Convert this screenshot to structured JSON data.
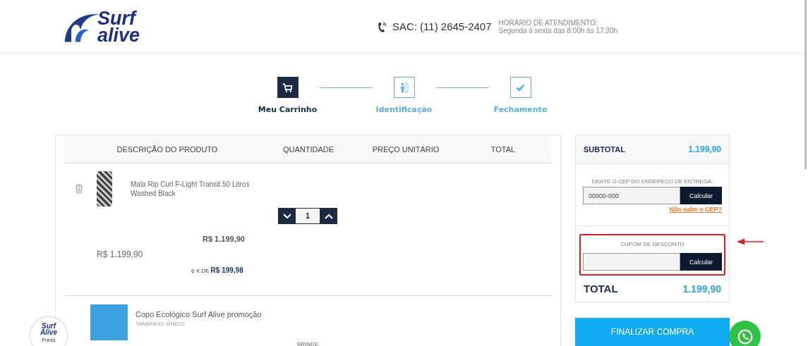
{
  "header": {
    "logo": {
      "line_1": "Surf",
      "line_2": "alive"
    },
    "phone": "SAC: (11) 2645-2407",
    "hours_title": "HORÁRIO DE ATENDIMENTO:",
    "hours": "Segunda à sexta das 8:00h às 17:30h"
  },
  "steps": [
    {
      "label": "Meu Carrinho",
      "kind": "cart",
      "selected": true
    },
    {
      "label": "Identificação",
      "kind": "person",
      "selected": false
    },
    {
      "label": "Fechamento",
      "kind": "check",
      "selected": false
    }
  ],
  "cart": {
    "columns": [
      "DESCRIÇÃO DO PRODUTO",
      "QUANTIDADE",
      "PREÇO UNITÁRIO",
      "TOTAL"
    ],
    "items": [
      {
        "kind": "product",
        "name": "Mala Rip Curl F-Light Transit 50 Litros Washed Black",
        "quantity": "1",
        "unit_price": "R$ 1.199,90",
        "price": "R$ 1.199,90",
        "installments": "6 X DE **R$ 199,98**"
      },
      {
        "kind": "gift",
        "name": "Copo Ecológico Surf Alive promoção",
        "size": "TAMANHO: ÚNICO",
        "tag": "BRINDE"
      }
    ]
  },
  "summary": {
    "subtotal_label": "SUBTOTAL",
    "subtotal": "1.199,90",
    "cep_label": "DIGITE O CEP DO ENDEREÇO DE ENTREGA:",
    "cep_placeholder": "00000-000",
    "cep_button": "Calcular",
    "cep_link": "Não sabe o CEP?",
    "coupon_label": "CUPOM DE DESCONTO",
    "coupon_button": "Calcular",
    "coupon_highlighted": true,
    "total_label": "TOTAL",
    "total": "1.199,90",
    "checkout_button": "FINALIZAR COMPRA"
  },
  "points_badge": {
    "line_1": "Surf",
    "line_2": "Alive",
    "line_3": "Points"
  }
}
